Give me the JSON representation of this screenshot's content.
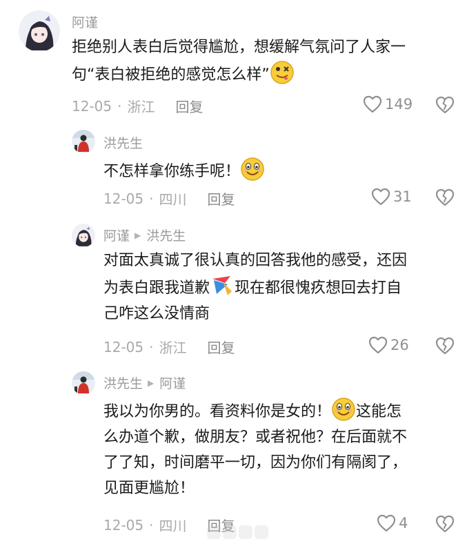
{
  "comments": [
    {
      "user": "阿谨",
      "line1": "拒绝别人表白后觉得尴尬，想缓解气氛问了人家一",
      "line2": "句“表白被拒绝的感觉怎么样”",
      "date": "12-05",
      "location": "浙江",
      "reply": "回复",
      "likes": "149"
    },
    {
      "user": "洪先生",
      "line1": "不怎样拿你练手呢！",
      "date": "12-05",
      "location": "四川",
      "reply": "回复",
      "likes": "31"
    },
    {
      "user": "阿谨",
      "reply_to": "洪先生",
      "line1": "对面太真诚了很认真的回答我他的感受，还因",
      "line2a": "为表白跟我道歉",
      "line2b": "现在都很愧疚想回去打自",
      "line3": "己咋这么没情商",
      "date": "12-05",
      "location": "浙江",
      "reply": "回复",
      "likes": "26"
    },
    {
      "user": "洪先生",
      "reply_to": "阿谨",
      "line1a": "我以为你男的。看资料你是女的！",
      "line1b": "这能怎",
      "line2": "么办道个歉，做朋友？或者祝他？在后面就不",
      "line3": "了了知，时间磨平一切，因为你们有隔阂了，",
      "line4": "见面更尴尬！",
      "date": "12-05",
      "location": "四川",
      "reply": "回复",
      "likes": "4"
    }
  ],
  "separator": "·",
  "colors": {
    "meta": "#a9a9a9",
    "name": "#9a9a9a",
    "text": "#1a1a1a"
  },
  "icons": [
    "avatar-anime-girl",
    "avatar-man-red-jacket",
    "heart-outline-icon",
    "broken-heart-icon",
    "grinning-face-emoji",
    "tongue-out-face-emoji",
    "ribbon-emoji"
  ]
}
